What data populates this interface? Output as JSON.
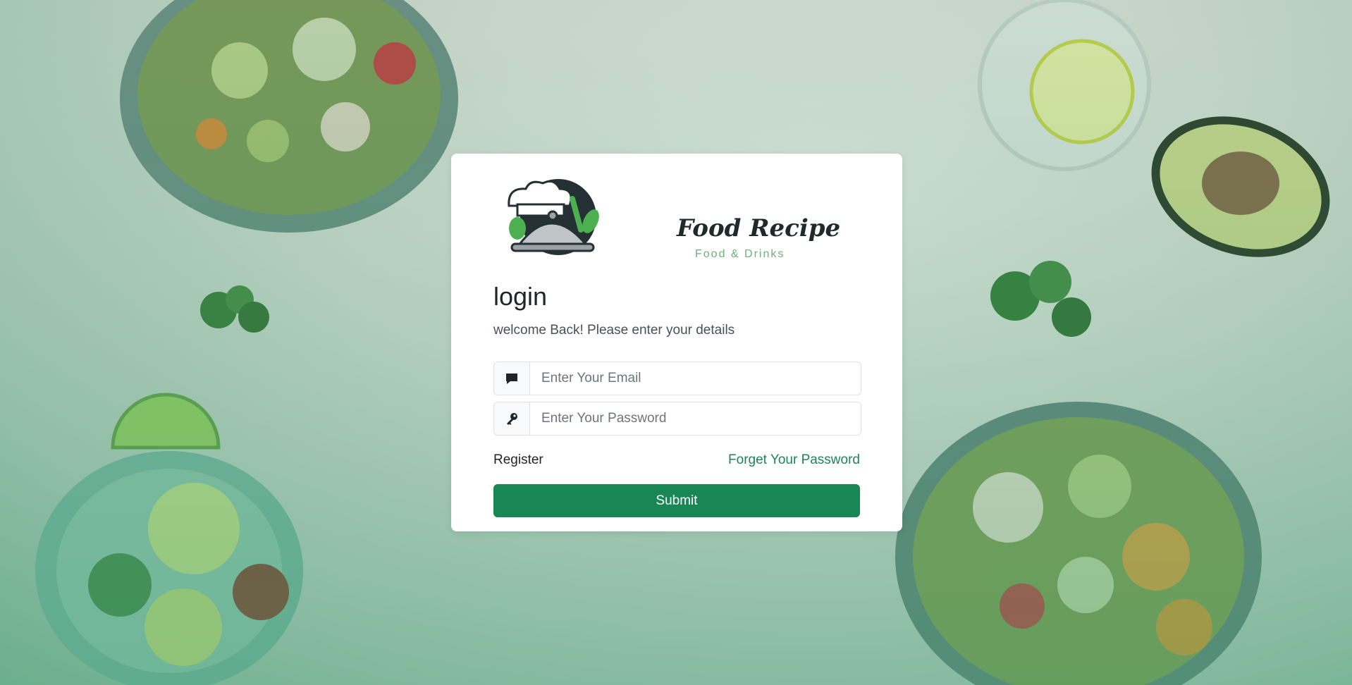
{
  "brand": {
    "title": "Food Recipe",
    "subtitle": "Food & Drinks",
    "logo_icon": "chef-cloche-icon"
  },
  "login": {
    "title": "login",
    "subtitle": "welcome Back! Please enter your details"
  },
  "email": {
    "icon": "chat-bubble-icon",
    "placeholder": "Enter Your Email",
    "value": ""
  },
  "password": {
    "icon": "key-icon",
    "placeholder": "Enter Your Password",
    "value": ""
  },
  "links": {
    "register": "Register",
    "forgot": "Forget Your Password"
  },
  "submit_label": "Submit",
  "colors": {
    "accent": "#198754",
    "text": "#212529",
    "muted": "#495057",
    "logo_green": "#6fb07c"
  }
}
